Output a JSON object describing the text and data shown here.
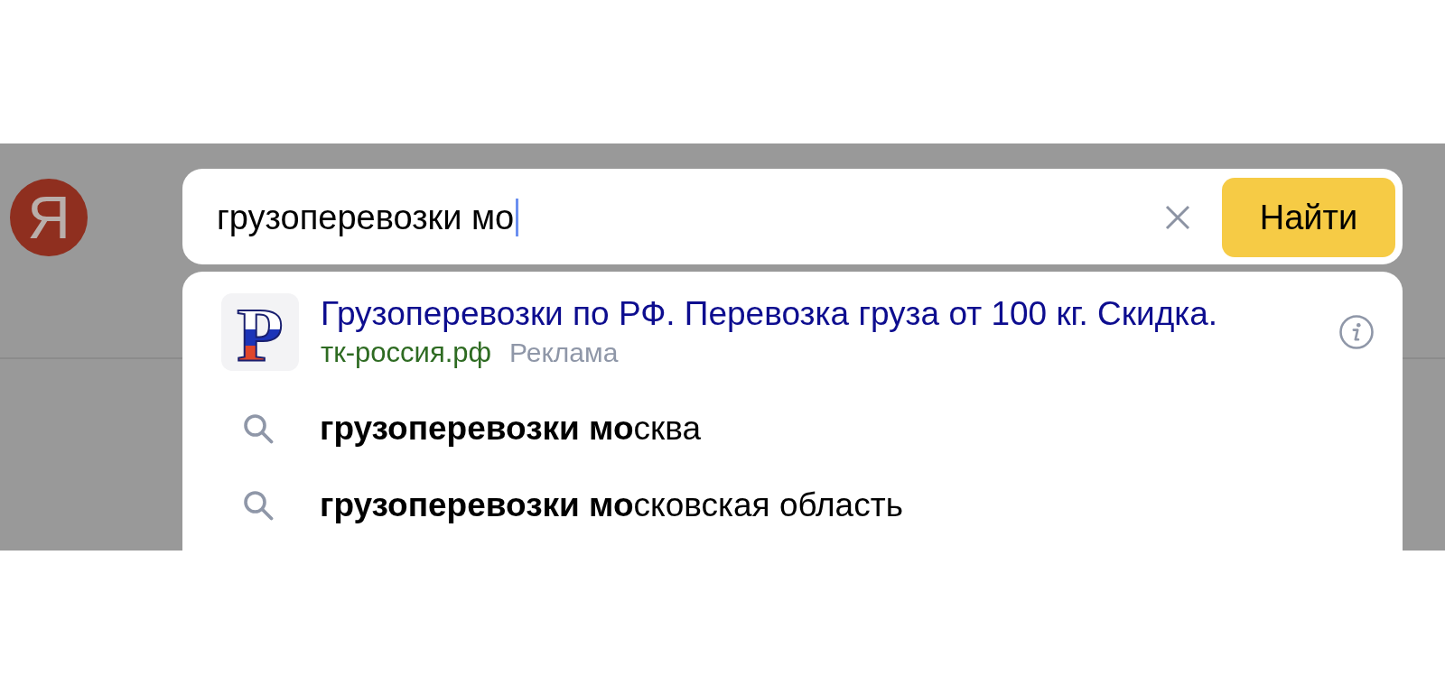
{
  "logo": {
    "letter": "Я"
  },
  "search": {
    "value": "грузоперевозки мо",
    "focused": true,
    "button": "Найти"
  },
  "suggestions": [
    {
      "kind": "ad",
      "logo_letter": "Р",
      "title": "Грузоперевозки по РФ. Перевозка груза от 100 кг. Скидка.",
      "url": "тк-россия.рф",
      "label": "Реклама"
    },
    {
      "kind": "query",
      "text": "**грузоперевозки мо**сква"
    },
    {
      "kind": "query",
      "text": "**грузоперевозки мо**сковская область"
    }
  ]
}
